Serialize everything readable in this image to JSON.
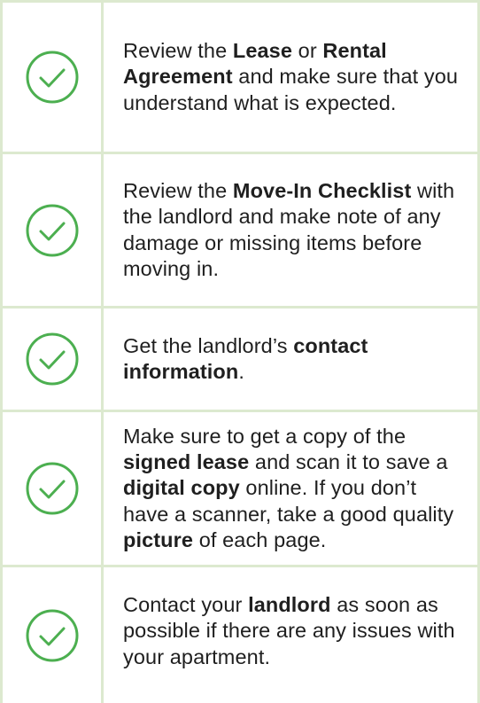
{
  "colors": {
    "accent_green": "#4caf50",
    "border_green": "#dce9cf",
    "text": "#1f1f1f"
  },
  "items": [
    {
      "icon": "check-circle-icon",
      "segments": [
        {
          "text": "Review the ",
          "bold": false
        },
        {
          "text": "Lease",
          "bold": true
        },
        {
          "text": " or ",
          "bold": false
        },
        {
          "text": "Rental Agreement",
          "bold": true
        },
        {
          "text": " and make sure that you understand what is expected.",
          "bold": false
        }
      ]
    },
    {
      "icon": "check-circle-icon",
      "segments": [
        {
          "text": "Review the ",
          "bold": false
        },
        {
          "text": "Move-In Checklist",
          "bold": true
        },
        {
          "text": " with the landlord and make note of any damage or missing items before moving in.",
          "bold": false
        }
      ]
    },
    {
      "icon": "check-circle-icon",
      "segments": [
        {
          "text": "Get the landlord’s ",
          "bold": false
        },
        {
          "text": "contact information",
          "bold": true
        },
        {
          "text": ".",
          "bold": false
        }
      ]
    },
    {
      "icon": "check-circle-icon",
      "segments": [
        {
          "text": "Make sure to get a copy of the ",
          "bold": false
        },
        {
          "text": "signed lease",
          "bold": true
        },
        {
          "text": " and scan it to save a ",
          "bold": false
        },
        {
          "text": "digital copy",
          "bold": true
        },
        {
          "text": " online. If you don’t have a scanner, take a good quality ",
          "bold": false
        },
        {
          "text": "picture",
          "bold": true
        },
        {
          "text": " of each page.",
          "bold": false
        }
      ]
    },
    {
      "icon": "check-circle-icon",
      "segments": [
        {
          "text": "Contact your ",
          "bold": false
        },
        {
          "text": "landlord",
          "bold": true
        },
        {
          "text": " as soon as possible if there are any issues with your apartment.",
          "bold": false
        }
      ]
    }
  ]
}
